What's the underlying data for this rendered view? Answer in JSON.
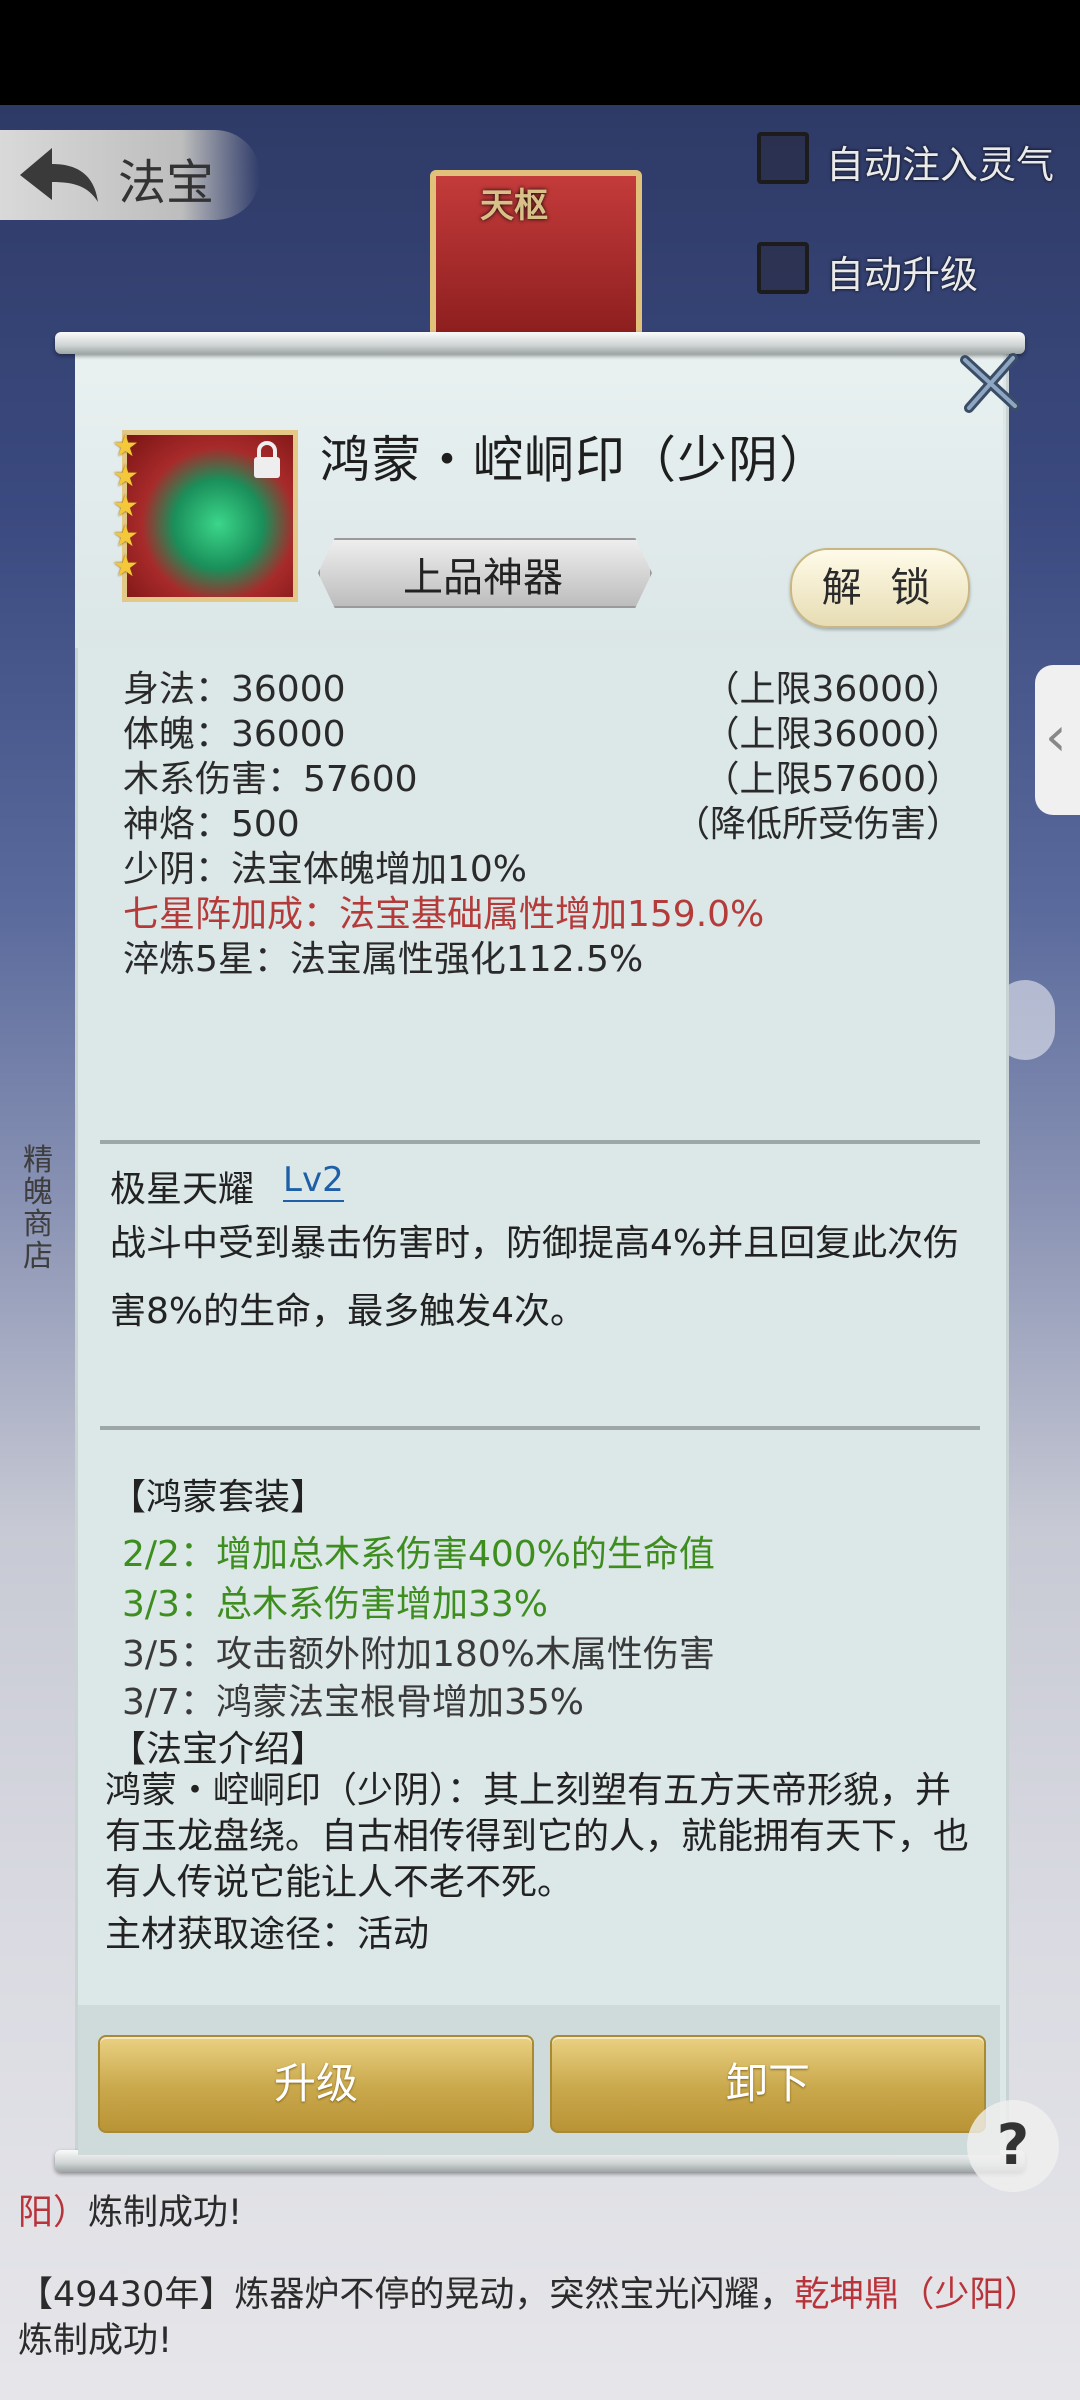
{
  "header": {
    "title": "法宝",
    "center_label": "天枢"
  },
  "options": {
    "auto_inject": "自动注入灵气",
    "auto_upgrade": "自动升级"
  },
  "side": {
    "shop_label": "精魄商店"
  },
  "item": {
    "name": "鸿蒙・崆峒印（少阴）",
    "grade": "上品神器",
    "stars": 5,
    "unlock_label": "解 锁"
  },
  "attributes": [
    {
      "label": "身法：36000",
      "limit": "（上限36000）"
    },
    {
      "label": "体魄：36000",
      "limit": "（上限36000）"
    },
    {
      "label": "木系伤害：57600",
      "limit": "（上限57600）"
    },
    {
      "label": "神烙：500",
      "limit": "（降低所受伤害）"
    }
  ],
  "bonuses": [
    {
      "text": "少阴：法宝体魄增加10%"
    },
    {
      "text": "七星阵加成：法宝基础属性增加159.0%",
      "color": "#b53b3b"
    },
    {
      "text": "淬炼5星：法宝属性强化112.5%"
    }
  ],
  "skill": {
    "name": "极星天耀",
    "level": "Lv2",
    "description": "战斗中受到暴击伤害时，防御提高4%并且回复此次伤害8%的生命，最多触发4次。"
  },
  "suite": {
    "title": "【鸿蒙套装】",
    "items": [
      {
        "text": "2/2：增加总木系伤害400%的生命值",
        "active": true
      },
      {
        "text": "3/3：总木系伤害增加33%",
        "active": true
      },
      {
        "text": "3/5：攻击额外附加180%木属性伤害",
        "active": false
      },
      {
        "text": "3/7：鸿蒙法宝根骨增加35%",
        "active": false
      }
    ]
  },
  "intro": {
    "title": "【法宝介绍】",
    "text": "鸿蒙・崆峒印（少阴）：其上刻塑有五方天帝形貌，并有玉龙盘绕。自古相传得到它的人，就能拥有天下，也有人传说它能让人不老不死。",
    "source": "主材获取途径：活动"
  },
  "buttons": {
    "upgrade": "升级",
    "unequip": "卸下"
  },
  "log": [
    {
      "prefix": "【49430年】炼器炉不停的晃动，突然宝光闪耀，",
      "item": "乾坤鼎（少阳）",
      "suffix": "炼制成功!"
    }
  ],
  "log_partial": {
    "line1_red": "阳）",
    "line1_rest": "炼制成功!"
  },
  "colors": {
    "gold_button": "#c9a84b",
    "red_text": "#b53b3b",
    "green_text": "#3d8d1f",
    "panel_bg": "#dce7e7"
  }
}
